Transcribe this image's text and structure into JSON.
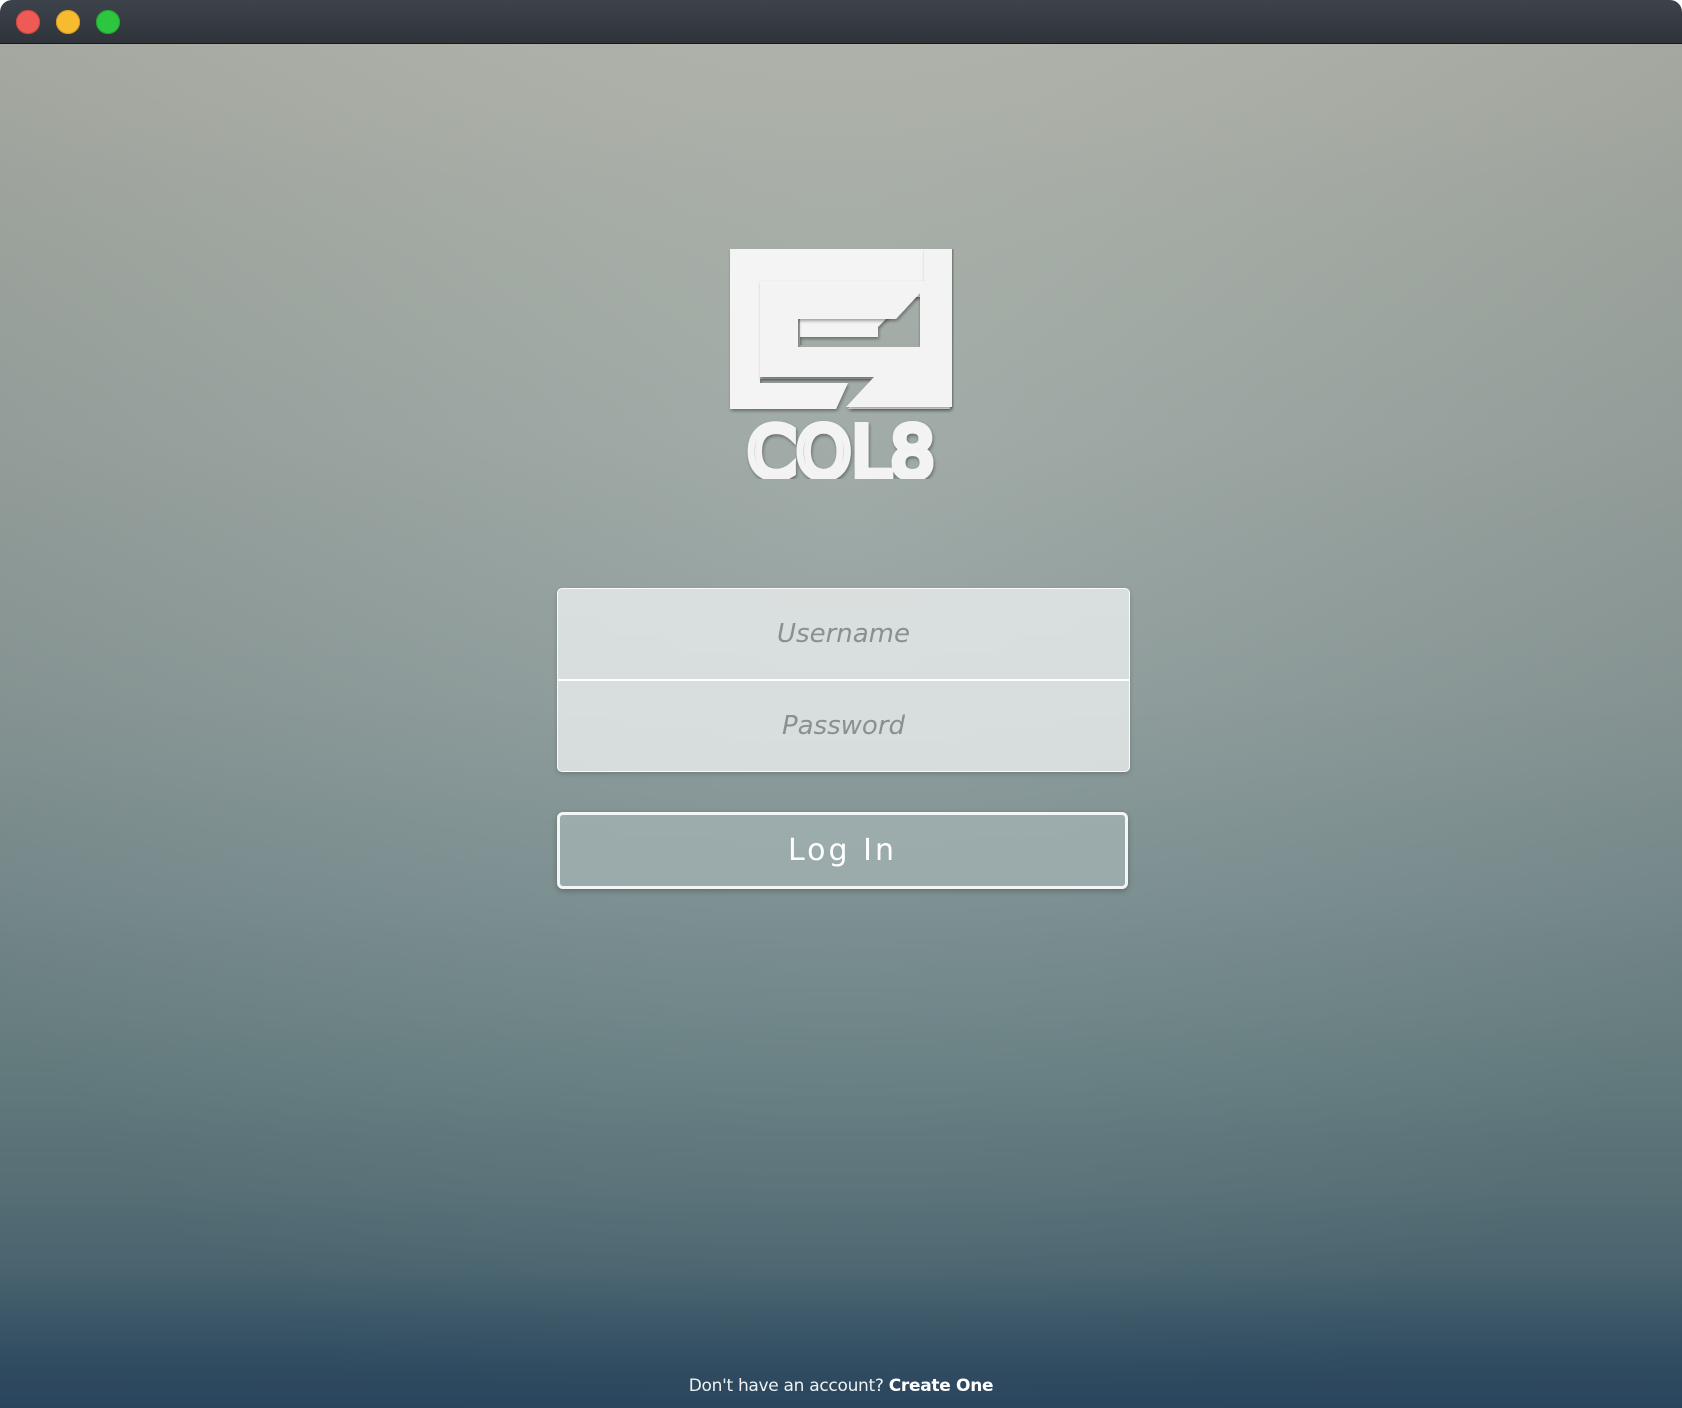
{
  "window": {
    "controls": {
      "close": "close-button",
      "minimize": "minimize-button",
      "zoom": "zoom-button"
    }
  },
  "brand": {
    "logo_text": "COL8",
    "icon": "col8-logo"
  },
  "login": {
    "username_placeholder": "Username",
    "password_placeholder": "Password",
    "submit_label": "Log In"
  },
  "signup": {
    "prompt": "Don't have an account?",
    "link_label": "Create One"
  },
  "colors": {
    "close": "#ee5b54",
    "minimize": "#f6bb2e",
    "zoom": "#2cc73f",
    "titlebar": "#363b42",
    "background_top": "#b3b6ad",
    "background_bottom": "#34526a"
  }
}
